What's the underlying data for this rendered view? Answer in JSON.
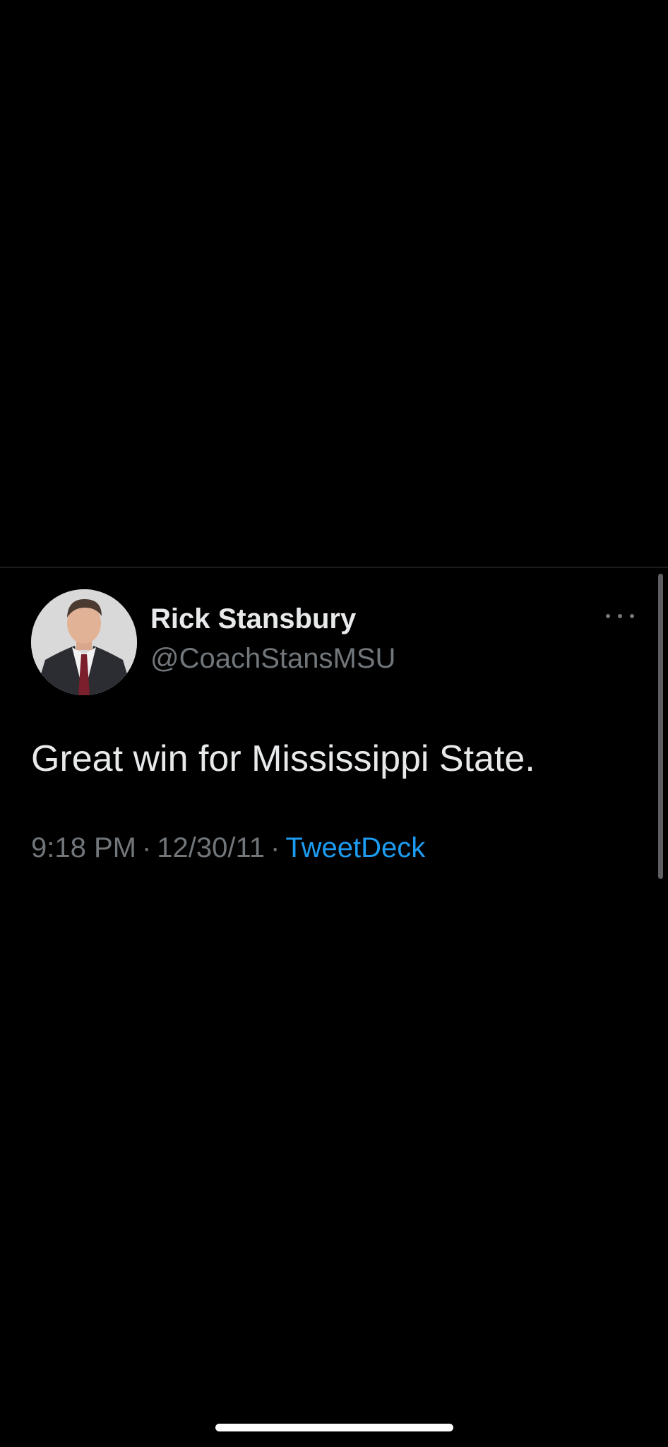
{
  "tweet": {
    "display_name": "Rick Stansbury",
    "handle": "@CoachStansMSU",
    "text": "Great win for Mississippi State.",
    "time": "9:18 PM",
    "separator": "·",
    "date": "12/30/11",
    "source": "TweetDeck",
    "more_icon": "more-horizontal-icon"
  },
  "colors": {
    "background": "#000000",
    "primary_text": "#e7e9ea",
    "secondary_text": "#71767b",
    "link": "#1d9bf0"
  }
}
